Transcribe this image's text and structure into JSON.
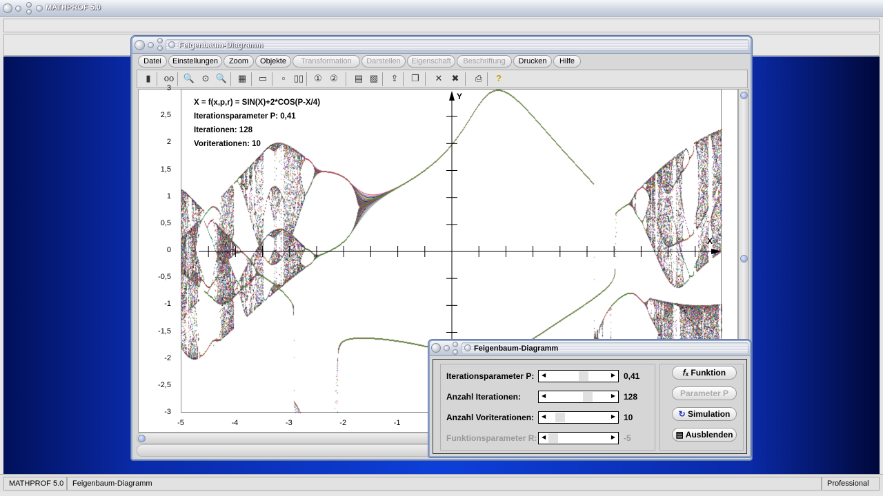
{
  "app": {
    "title": "MATHPROF 5.0"
  },
  "window": {
    "title": "Feigenbaum-Diagramm",
    "menu": [
      {
        "label": "Datei",
        "enabled": true
      },
      {
        "label": "Einstellungen",
        "enabled": true
      },
      {
        "label": "Zoom",
        "enabled": true
      },
      {
        "label": "Objekte",
        "enabled": true
      },
      {
        "label": "Transformation",
        "enabled": false
      },
      {
        "label": "Darstellen",
        "enabled": false
      },
      {
        "label": "Eigenschaft",
        "enabled": false
      },
      {
        "label": "Beschriftung",
        "enabled": false
      },
      {
        "label": "Drucken",
        "enabled": true
      },
      {
        "label": "Hilfe",
        "enabled": true
      }
    ],
    "toolbar_icons": [
      "panel-icon",
      "glasses-icon",
      "zoom-out-icon",
      "zoom-reset-icon",
      "zoom-in-icon",
      "properties-icon",
      "window-icon",
      "frame-icon",
      "double-frame-icon",
      "circle-1-icon",
      "circle-2-icon",
      "table-icon",
      "settings-sheet-icon",
      "export-icon",
      "copy-icon",
      "cross-icon",
      "double-cross-icon",
      "print-icon",
      "help-icon"
    ]
  },
  "plot": {
    "info": {
      "function": "X = f(x,p,r) = SIN(X)+2*COS(P-X/4)",
      "parameter": "Iterationsparameter P: 0,41",
      "iterations": "Iterationen: 128",
      "preiterations": "Voriterationen: 10"
    },
    "x_axis_label": "X",
    "y_axis_label": "Y",
    "xlim": [
      -5,
      5
    ],
    "ylim": [
      -3,
      3
    ],
    "y_ticks": [
      "3",
      "2,5",
      "2",
      "1,5",
      "1",
      "0,5",
      "0",
      "-0,5",
      "-1",
      "-1,5",
      "-2",
      "-2,5",
      "-3"
    ],
    "x_ticks": [
      "-5",
      "-4",
      "-3",
      "-2",
      "-1"
    ]
  },
  "dialog": {
    "title": "Feigenbaum-Diagramm",
    "rows": [
      {
        "label": "Iterationsparameter P:",
        "value": "0,41",
        "position": 0.55,
        "enabled": true
      },
      {
        "label": "Anzahl Iterationen:",
        "value": "128",
        "position": 0.62,
        "enabled": true
      },
      {
        "label": "Anzahl Voriterationen:",
        "value": "10",
        "position": 0.12,
        "enabled": true
      },
      {
        "label": "Funktionsparameter R:",
        "value": "-5",
        "position": 0.0,
        "enabled": false
      }
    ],
    "buttons": [
      {
        "label": "Funktion",
        "icon": "fx-icon",
        "enabled": true
      },
      {
        "label": "Parameter P",
        "enabled": false
      },
      {
        "label": "Simulation",
        "icon": "refresh-icon",
        "enabled": true
      },
      {
        "label": "Ausblenden",
        "icon": "hide-icon",
        "enabled": true
      }
    ]
  },
  "status": {
    "app": "MATHPROF 5.0",
    "module": "Feigenbaum-Diagramm",
    "edition": "Professional"
  }
}
